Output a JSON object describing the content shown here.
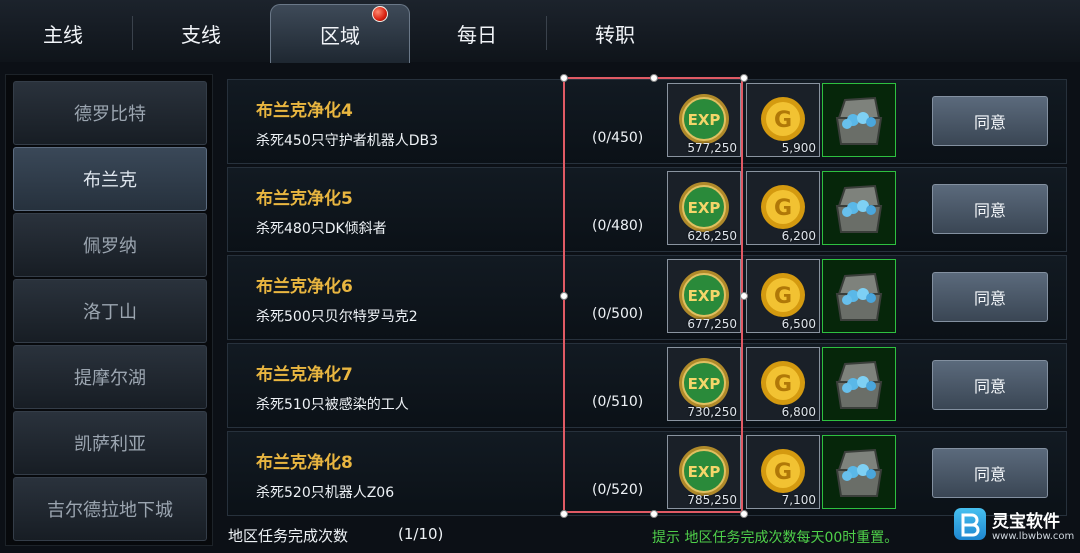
{
  "tabs": [
    {
      "label": "主线"
    },
    {
      "label": "支线"
    },
    {
      "label": "区域",
      "active": true,
      "notification": true
    },
    {
      "label": "每日"
    },
    {
      "label": "转职"
    }
  ],
  "regions": [
    {
      "label": "德罗比特"
    },
    {
      "label": "布兰克",
      "active": true
    },
    {
      "label": "佩罗纳"
    },
    {
      "label": "洛丁山"
    },
    {
      "label": "提摩尔湖"
    },
    {
      "label": "凯萨利亚"
    },
    {
      "label": "吉尔德拉地下城"
    }
  ],
  "quests": [
    {
      "title": "布兰克净化4",
      "desc": "杀死450只守护者机器人DB3",
      "progress": "(0/450)",
      "exp": "577,250",
      "gold": "5,900",
      "action": "同意"
    },
    {
      "title": "布兰克净化5",
      "desc": "杀死480只DK倾斜者",
      "progress": "(0/480)",
      "exp": "626,250",
      "gold": "6,200",
      "action": "同意"
    },
    {
      "title": "布兰克净化6",
      "desc": "杀死500只贝尔特罗马克2",
      "progress": "(0/500)",
      "exp": "677,250",
      "gold": "6,500",
      "action": "同意"
    },
    {
      "title": "布兰克净化7",
      "desc": "杀死510只被感染的工人",
      "progress": "(0/510)",
      "exp": "730,250",
      "gold": "6,800",
      "action": "同意"
    },
    {
      "title": "布兰克净化8",
      "desc": "杀死520只机器人Z06",
      "progress": "(0/520)",
      "exp": "785,250",
      "gold": "7,100",
      "action": "同意"
    }
  ],
  "reward_icons": {
    "exp": "exp-orb-icon",
    "gold": "gold-coin-icon",
    "chest": "treasure-chest-icon",
    "exp_label": "EXP",
    "gold_label": "G"
  },
  "footer": {
    "label": "地区任务完成次数",
    "count": "(1/10)",
    "hint": "提示  地区任务完成次数每天00时重置。"
  },
  "watermark": {
    "name": "灵宝软件",
    "url": "www.lbwbw.com"
  },
  "colors": {
    "quest_title": "#e9b640",
    "hint": "#4fd04a",
    "selection": "#e05a64",
    "chest_border": "#2ec040"
  }
}
